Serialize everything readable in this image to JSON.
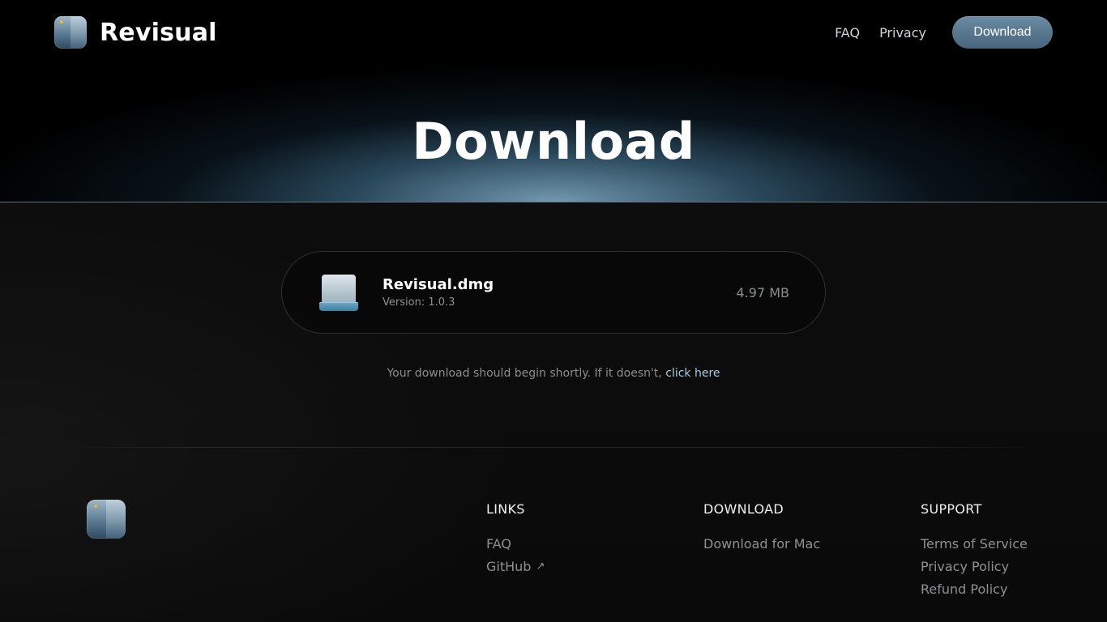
{
  "header": {
    "brand_name": "Revisual",
    "nav": {
      "faq": "FAQ",
      "privacy": "Privacy",
      "download_button": "Download"
    }
  },
  "hero": {
    "title": "Download"
  },
  "file": {
    "name": "Revisual.dmg",
    "version": "Version: 1.0.3",
    "size": "4.97 MB",
    "icon": "drive-icon"
  },
  "notice": {
    "text": "Your download should begin shortly. If it doesn't, ",
    "link": "click here"
  },
  "footer": {
    "links": {
      "heading": "LINKS",
      "items": [
        "FAQ",
        "GitHub"
      ]
    },
    "download": {
      "heading": "DOWNLOAD",
      "items": [
        "Download for Mac"
      ]
    },
    "support": {
      "heading": "SUPPORT",
      "items": [
        "Terms of Service",
        "Privacy Policy",
        "Refund Policy"
      ]
    }
  },
  "colors": {
    "accent_button": "#5a7a92",
    "link": "#a9c9e0",
    "muted_text": "#8b8d90"
  }
}
